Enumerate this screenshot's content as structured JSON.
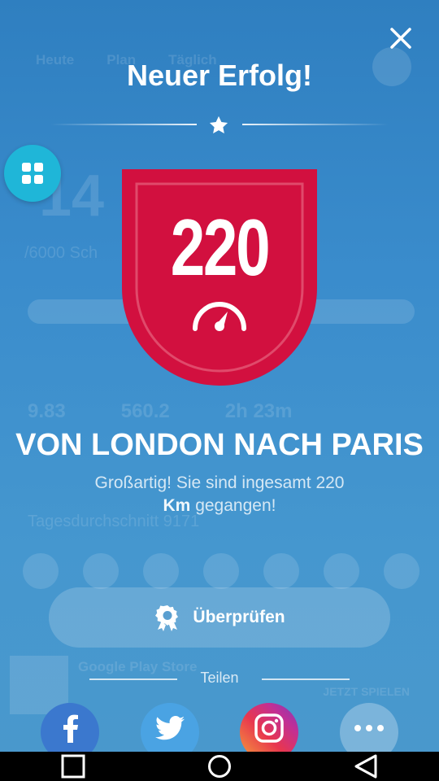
{
  "background": {
    "tabs": [
      "Heute",
      "Plan",
      "Täglich"
    ],
    "big_number": "14",
    "goal_text": "/6000 Sch",
    "stats": [
      "9.83",
      "560.2",
      "2h 23m"
    ],
    "daily_avg": "Tagesdurchschnitt 9171",
    "ad": {
      "title": "Google Play Store",
      "cta": "JETZT SPIELEN"
    }
  },
  "dialog": {
    "title": "Neuer Erfolg!",
    "badge_value": "220",
    "headline": "VON LONDON NACH PARIS",
    "description_pre": "Großartig! Sie sind ingesamt 220",
    "description_unit": "Km",
    "description_post": " gegangen!",
    "review_label": "Überprüfen",
    "share_label": "Teilen"
  },
  "colors": {
    "badge_red": "#d2103f",
    "apps_button": "#1fb6d8",
    "facebook": "#3b78ce",
    "twitter": "#4aa3e3"
  },
  "icons": [
    "close-icon",
    "star-icon",
    "grid-icon",
    "speedometer-icon",
    "award-icon",
    "facebook-icon",
    "twitter-icon",
    "instagram-icon",
    "more-icon",
    "nav-recents-icon",
    "nav-home-icon",
    "nav-back-icon"
  ]
}
